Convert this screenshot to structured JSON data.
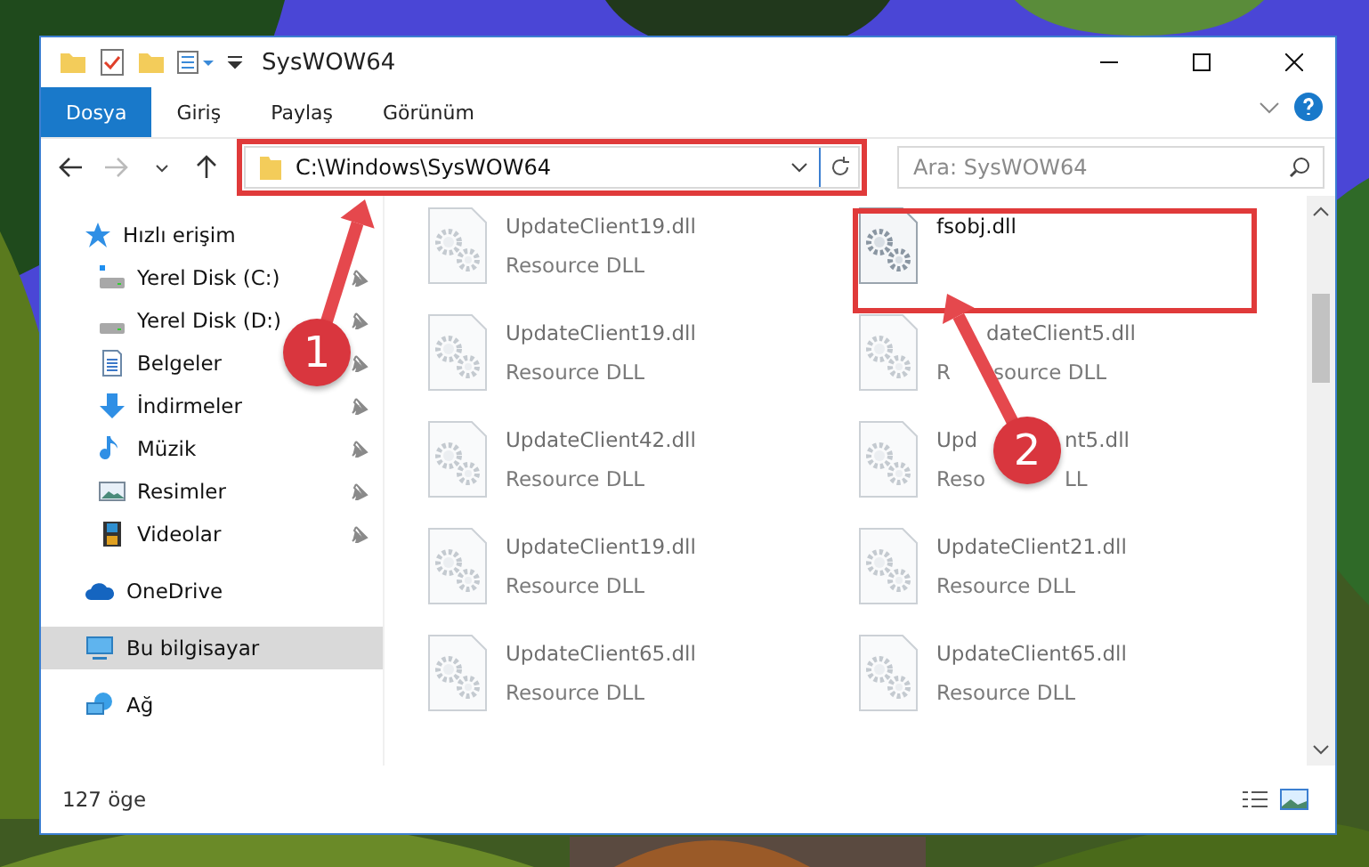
{
  "window": {
    "title": "SysWOW64"
  },
  "ribbon_tabs": [
    {
      "label": "Dosya",
      "selected": true
    },
    {
      "label": "Giriş",
      "selected": false
    },
    {
      "label": "Paylaş",
      "selected": false
    },
    {
      "label": "Görünüm",
      "selected": false
    }
  ],
  "address": {
    "path": "C:\\Windows\\SysWOW64"
  },
  "search": {
    "placeholder": "Ara: SysWOW64"
  },
  "sidebar": {
    "items": [
      {
        "label": "Hızlı erişim",
        "kind": "quick",
        "selected": false,
        "pinned": false
      },
      {
        "label": "Yerel Disk (C:)",
        "kind": "system-drive",
        "selected": false,
        "pinned": true
      },
      {
        "label": "Yerel Disk (D:)",
        "kind": "drive",
        "selected": false,
        "pinned": true
      },
      {
        "label": "Belgeler",
        "kind": "documents",
        "selected": false,
        "pinned": true
      },
      {
        "label": "İndirmeler",
        "kind": "downloads",
        "selected": false,
        "pinned": true
      },
      {
        "label": "Müzik",
        "kind": "music",
        "selected": false,
        "pinned": true
      },
      {
        "label": "Resimler",
        "kind": "pictures",
        "selected": false,
        "pinned": true
      },
      {
        "label": "Videolar",
        "kind": "videos",
        "selected": false,
        "pinned": true
      },
      {
        "label": "OneDrive",
        "kind": "cloud",
        "selected": false,
        "pinned": false
      },
      {
        "label": "Bu bilgisayar",
        "kind": "computer",
        "selected": true,
        "pinned": false
      },
      {
        "label": "Ağ",
        "kind": "network",
        "selected": false,
        "pinned": false
      }
    ]
  },
  "files": [
    {
      "name_parts": [
        "UpdateClient19.dll"
      ],
      "type_parts": [
        "Resource DLL"
      ],
      "faded": true
    },
    {
      "name_parts": [
        "fsobj.dll"
      ],
      "faded": false
    },
    {
      "name_parts": [
        "UpdateClient19.dll"
      ],
      "type_parts": [
        "Resource DLL"
      ],
      "faded": true
    },
    {
      "name_parts": [
        "dateClient5.dll"
      ],
      "type_parts": [
        "R",
        "source DLL"
      ],
      "faded": true
    },
    {
      "name_parts": [
        "UpdateClient42.dll"
      ],
      "type_parts": [
        "Resource DLL"
      ],
      "faded": true
    },
    {
      "name_parts": [
        "Upd",
        "nt5.dll"
      ],
      "type_parts": [
        "Reso",
        "LL"
      ],
      "faded": true
    },
    {
      "name_parts": [
        "UpdateClient19.dll"
      ],
      "type_parts": [
        "Resource DLL"
      ],
      "faded": true
    },
    {
      "name_parts": [
        "UpdateClient21.dll"
      ],
      "type_parts": [
        "Resource DLL"
      ],
      "faded": true
    },
    {
      "name_parts": [
        "UpdateClient65.dll"
      ],
      "type_parts": [
        "Resource DLL"
      ],
      "faded": true
    },
    {
      "name_parts": [
        "UpdateClient65.dll"
      ],
      "type_parts": [
        "Resource DLL"
      ],
      "faded": true
    }
  ],
  "annotations": [
    {
      "number": "1"
    },
    {
      "number": "2"
    }
  ],
  "status_bar": {
    "count": "127 öge"
  }
}
